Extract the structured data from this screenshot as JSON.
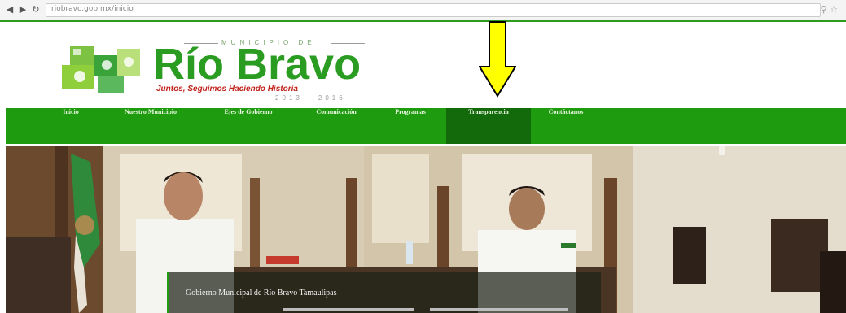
{
  "browser": {
    "back_icon": "back-arrow-icon",
    "forward_icon": "forward-arrow-icon",
    "reload_icon": "reload-icon",
    "url": "riobravo.gob.mx/inicio",
    "zoom_icon": "magnifier-icon",
    "star_icon": "star-icon"
  },
  "logo": {
    "municipio_label": "MUNICIPIO DE",
    "brand": "Río Bravo",
    "tagline": "Juntos, Seguimos Haciendo Historia",
    "years": "2013 - 2016"
  },
  "navbar": {
    "items": [
      {
        "label": "Inicio",
        "active": false
      },
      {
        "label": "Nuestro Municipio",
        "active": false
      },
      {
        "label": "Ejes de Gobierno",
        "active": false
      },
      {
        "label": "Comunicación",
        "active": false
      },
      {
        "label": "Programas",
        "active": false
      },
      {
        "label": "Transparencia",
        "active": true
      },
      {
        "label": "Contáctanos",
        "active": false
      }
    ]
  },
  "hero": {
    "caption": "Gobierno Municipal de Río Bravo Tamaulipas"
  },
  "colors": {
    "brand_green": "#1f9b0f",
    "active_green": "#136a0b",
    "tagline_red": "#c0211b",
    "arrow_yellow": "#ffff00"
  }
}
